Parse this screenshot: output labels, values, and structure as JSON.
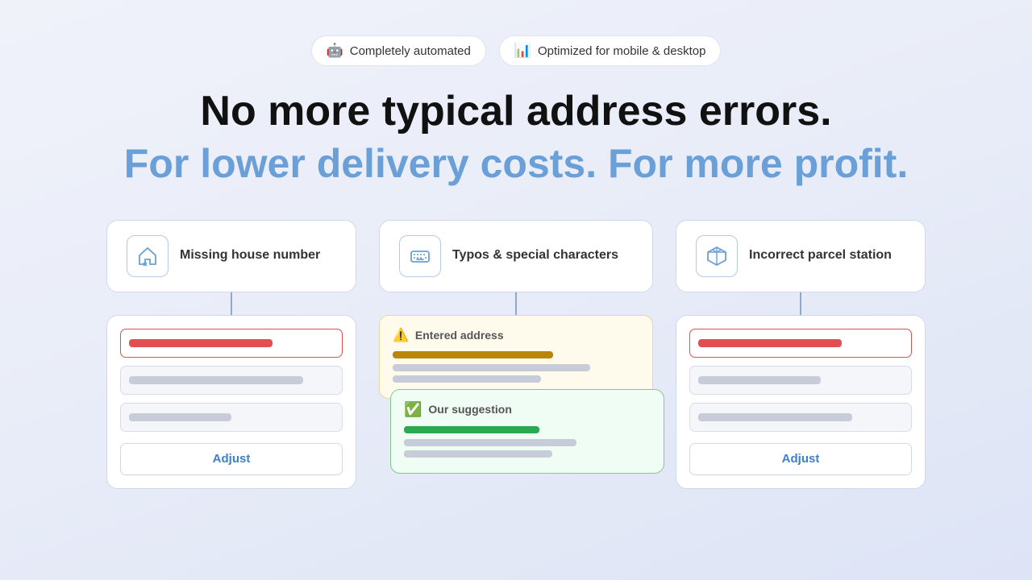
{
  "badges": [
    {
      "id": "automated",
      "icon": "🤖",
      "label": "Completely automated"
    },
    {
      "id": "mobile",
      "icon": "📊",
      "label": "Optimized for mobile & desktop"
    }
  ],
  "headline": {
    "line1": "No more typical address errors.",
    "line2": "For lower delivery costs. For more profit."
  },
  "cards": [
    {
      "id": "missing-house",
      "label": "Missing house number",
      "button": "Adjust"
    },
    {
      "id": "typos",
      "label": "Typos & special characters",
      "entered_label": "Entered address",
      "suggestion_label": "Our suggestion"
    },
    {
      "id": "parcel-station",
      "label": "Incorrect parcel station",
      "button": "Adjust"
    }
  ]
}
